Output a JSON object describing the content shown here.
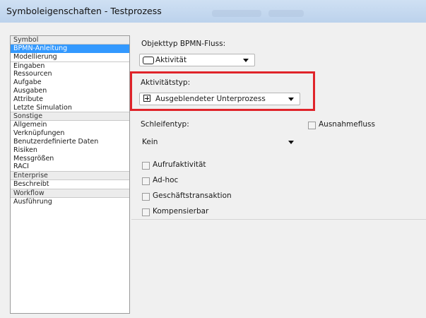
{
  "window": {
    "title": "Symboleigenschaften - Testprozess"
  },
  "sidebar": {
    "groups": [
      {
        "header": "Symbol",
        "items": [
          {
            "label": "BPMN-Anleitung",
            "selected": true
          },
          {
            "label": "Modellierung"
          }
        ]
      },
      {
        "header": "",
        "items": []
      }
    ],
    "symbol_header": "Symbol",
    "symbol_items": [
      "BPMN-Anleitung",
      "Modellierung",
      "Eingaben",
      "Ressourcen",
      "Aufgabe",
      "Ausgaben",
      "Attribute",
      "Letzte Simulation"
    ],
    "sonstige_header": "Sonstige",
    "sonstige_items": [
      "Allgemein",
      "Verknüpfungen",
      "Benutzerdefinierte Daten",
      "Risiken",
      "Messgrößen",
      "RACI"
    ],
    "enterprise_header": "Enterprise",
    "enterprise_items": [
      "Beschreibt"
    ],
    "workflow_header": "Workflow",
    "workflow_items": [
      "Ausführung"
    ]
  },
  "form": {
    "objekttyp_label": "Objekttyp BPMN-Fluss:",
    "objekttyp_value": "Aktivität",
    "aktivitaetstyp_label": "Aktivitätstyp:",
    "aktivitaetstyp_value": "Ausgeblendeter Unterprozess",
    "schleifentyp_label": "Schleifentyp:",
    "schleifentyp_value": "Kein",
    "ausnahmefluss_label": "Ausnahmefluss",
    "checkboxes": [
      "Aufrufaktivität",
      "Ad-hoc",
      "Geschäftstransaktion",
      "Kompensierbar"
    ]
  },
  "colors": {
    "selection": "#3399ff",
    "highlight_box": "#e0242a",
    "titlebar": "#cfe0f3"
  }
}
